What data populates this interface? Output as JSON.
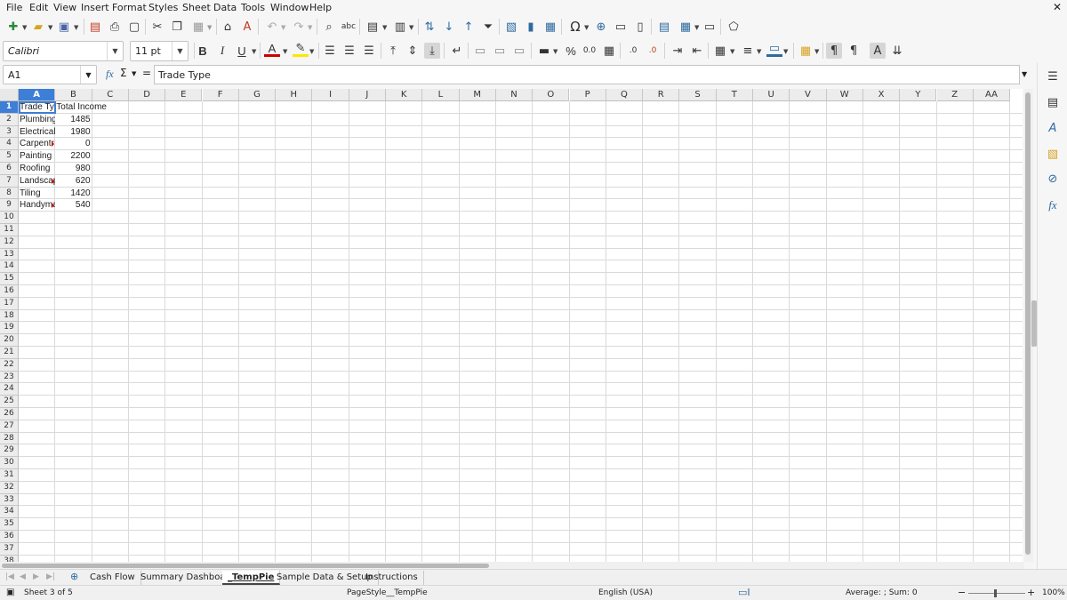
{
  "menu": [
    "File",
    "Edit",
    "View",
    "Insert",
    "Format",
    "Styles",
    "Sheet",
    "Data",
    "Tools",
    "Window",
    "Help"
  ],
  "toolbar": {
    "font_name": "Calibri",
    "font_size": "11 pt",
    "bold": "B",
    "italic": "I",
    "underline": "U",
    "font_color_label": "A",
    "percent": "%",
    "number_format": "0.0",
    "add_decimal": "0.0",
    "del_decimal": ".00"
  },
  "formula_bar": {
    "cell_ref": "A1",
    "fx": "fx",
    "sigma": "Σ",
    "equals": "=",
    "content": "Trade Type"
  },
  "grid": {
    "columns": [
      "A",
      "B",
      "C",
      "D",
      "E",
      "F",
      "G",
      "H",
      "I",
      "J",
      "K",
      "L",
      "M",
      "N",
      "O",
      "P",
      "Q",
      "R",
      "S",
      "T",
      "U",
      "V",
      "W",
      "X",
      "Y",
      "Z",
      "AA"
    ],
    "rows": [
      "1",
      "2",
      "3",
      "4",
      "5",
      "6",
      "7",
      "8",
      "9",
      "10",
      "11",
      "12",
      "13",
      "14",
      "15",
      "16",
      "17",
      "18",
      "19",
      "20",
      "21",
      "22",
      "23",
      "24",
      "25",
      "26",
      "27",
      "28",
      "29",
      "30",
      "31",
      "32",
      "33",
      "34",
      "35",
      "36",
      "37",
      "38"
    ],
    "selected_cell": "A1",
    "data": [
      [
        "Trade Type",
        "Total Income"
      ],
      [
        "Plumbing",
        "1485"
      ],
      [
        "Electrical",
        "1980"
      ],
      [
        "Carpentry",
        "0"
      ],
      [
        "Painting",
        "2200"
      ],
      [
        "Roofing",
        "980"
      ],
      [
        "Landscaping",
        "620"
      ],
      [
        "Tiling",
        "1420"
      ],
      [
        "Handyman",
        "540"
      ]
    ],
    "data_display": [
      [
        "Trade Typ",
        "Total Income"
      ],
      [
        "Plumbing",
        "1485"
      ],
      [
        "Electrical",
        "1980"
      ],
      [
        "Carpentr",
        "0"
      ],
      [
        "Painting",
        "2200"
      ],
      [
        "Roofing",
        "980"
      ],
      [
        "Landscap",
        "620"
      ],
      [
        "Tiling",
        "1420"
      ],
      [
        "Handyma",
        "540"
      ]
    ]
  },
  "tabs": [
    "Cash Flow",
    "Summary Dashboard",
    "_TempPie",
    "Sample Data & Setup",
    "Instructions"
  ],
  "active_tab": "_TempPie",
  "status": {
    "sheet": "Sheet 3 of 5",
    "page_style": "PageStyle__TempPie",
    "language": "English (USA)",
    "summary": "Average: ; Sum: 0",
    "zoom": "100%"
  },
  "colors": {
    "accent": "#3d7ed6",
    "truncation_marker": "#cc0000"
  }
}
